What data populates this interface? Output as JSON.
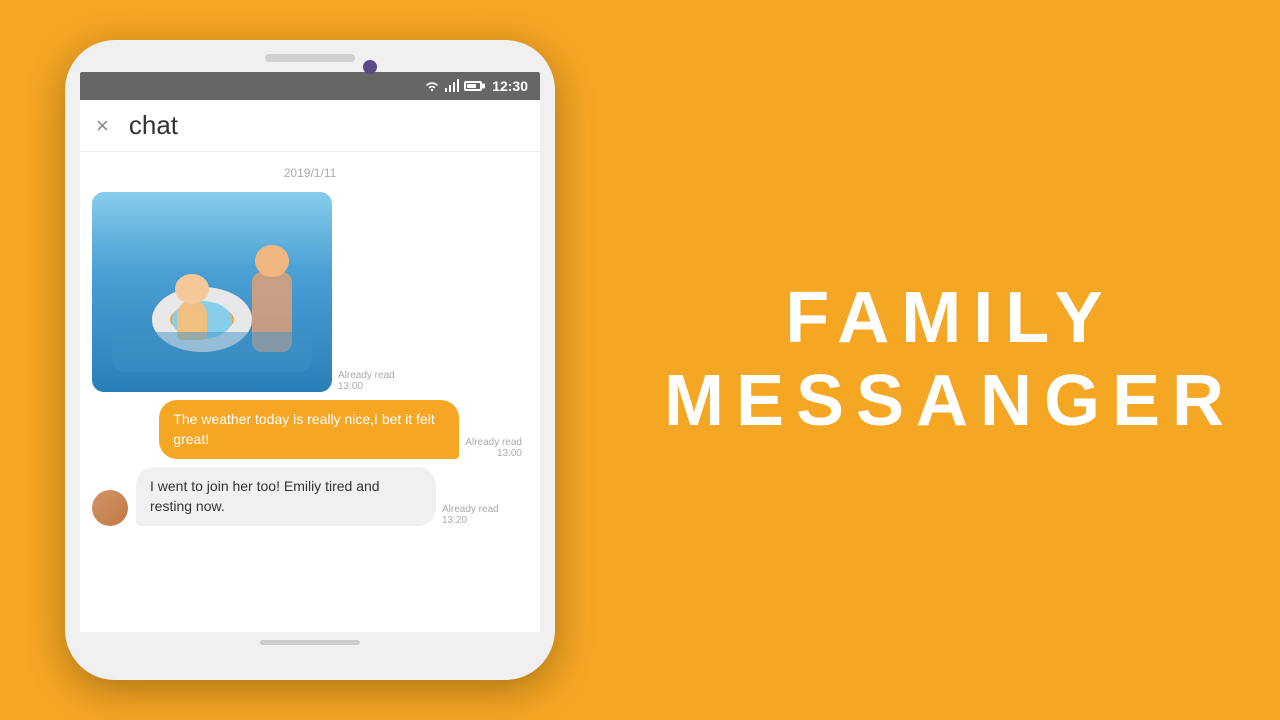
{
  "background_color": "#F5A623",
  "phone": {
    "status_bar": {
      "time": "12:30",
      "icons": [
        "wifi",
        "signal",
        "battery"
      ]
    },
    "header": {
      "close_label": "×",
      "title": "chat"
    },
    "messages": [
      {
        "type": "date",
        "text": "2019/1/11"
      },
      {
        "type": "incoming_image",
        "meta_read": "Already read",
        "meta_time": "13:00"
      },
      {
        "type": "outgoing",
        "text": "The weather today is really nice,I bet it felt great!",
        "meta_read": "Already read",
        "meta_time": "13:00"
      },
      {
        "type": "incoming",
        "text": "I went to join her too! Emiliy tired and resting now.",
        "meta_read": "Already read",
        "meta_time": "13:20"
      }
    ]
  },
  "app_title_line1": "FAMILY",
  "app_title_line2": "MESSANGER"
}
